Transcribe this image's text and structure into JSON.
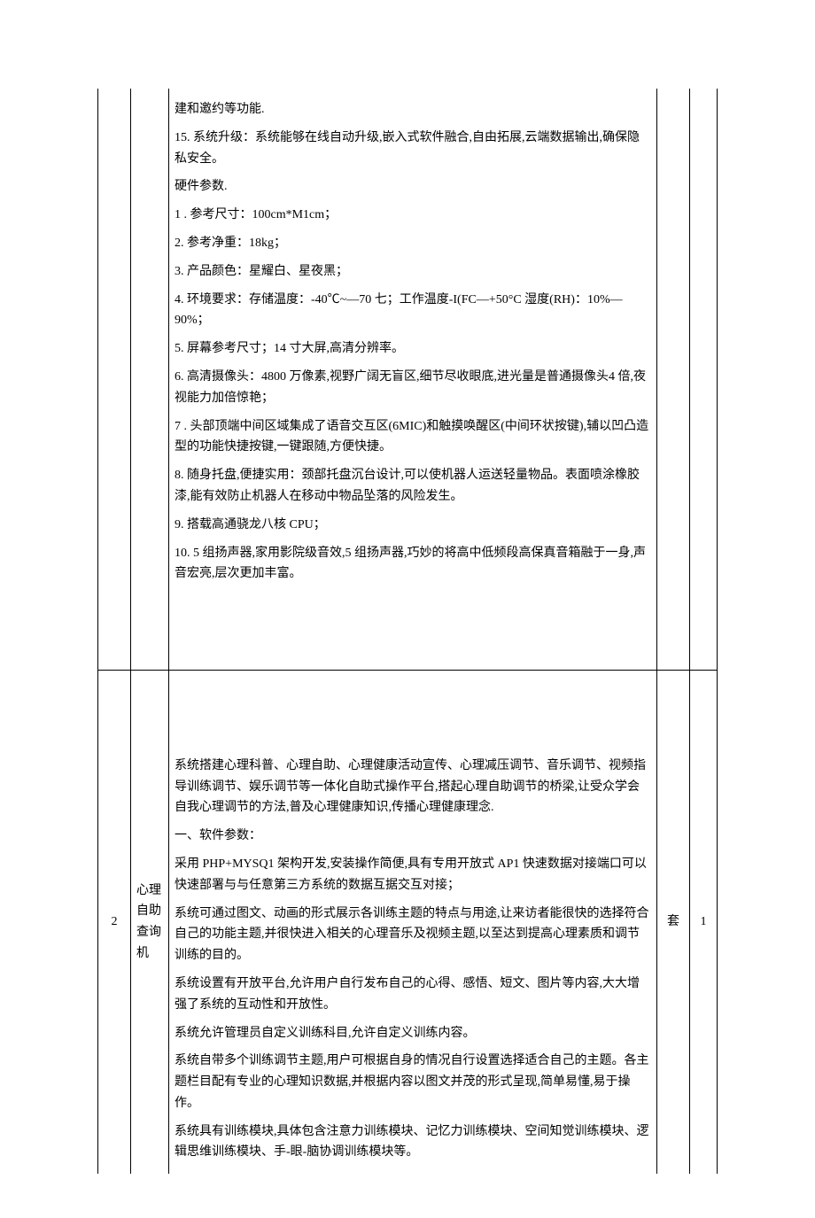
{
  "row1": {
    "idx": "",
    "name": "",
    "unit": "",
    "qty": "",
    "paragraphs": [
      "建和邀约等功能.",
      "15. 系统升级：系统能够在线自动升级,嵌入式软件融合,自由拓展,云端数据输出,确保隐私安全。",
      "硬件参数.",
      "1          . 参考尺寸：100cm*M1cm；",
      "2. 参考净重：18kg；",
      "3. 产品颜色：星耀白、星夜黑；",
      "4. 环境要求：存储温度：-40℃~—70 七；工作温度-I(FC—+50°C 湿度(RH)：10%—90%；",
      "5. 屏幕参考尺寸；14 寸大屏,高清分辨率。",
      "6. 高清摄像头：4800 万像素,视野广阔无盲区,细节尽收眼底,进光量是普通摄像头4 倍,夜视能力加倍惊艳；",
      "7          . 头部顶端中间区域集成了语音交互区(6MIC)和触摸唤醒区(中间环状按键),辅以凹凸造型的功能快捷按键,一键跟随,方便快捷。",
      "8. 随身托盘,便捷实用：颈部托盘沉台设计,可以使机器人运送轻量物品。表面喷涂橡胶漆,能有效防止机器人在移动中物品坠落的风险发生。",
      "9. 搭载高通骁龙八核 CPU；",
      "10. 5 组扬声器,家用影院级音效,5 组扬声器,巧妙的将高中低频段高保真音箱融于一身,声音宏亮,层次更加丰富。"
    ]
  },
  "row2": {
    "idx": "2",
    "name": "心理自助查询机",
    "unit": "套",
    "qty": "1",
    "paragraphs": [
      "系统搭建心理科普、心理自助、心理健康活动宣传、心理减压调节、音乐调节、视频指导训练调节、娱乐调节等一体化自助式操作平台,搭起心理自助调节的桥梁,让受众学会自我心理调节的方法,普及心理健康知识,传播心理健康理念.",
      "一、软件参数：",
      "采用 PHP+MYSQ1 架构开发,安装操作简便,具有专用开放式 AP1 快速数据对接端口可以快速部署与与任意第三方系统的数据互据交互对接；",
      "系统可通过图文、动画的形式展示各训练主题的特点与用途,让来访者能很快的选择符合自己的功能主题,并很快进入相关的心理音乐及视频主题,以至达到提高心理素质和调节训练的目的。",
      "系统设置有开放平台,允许用户自行发布自己的心得、感悟、短文、图片等内容,大大增强了系统的互动性和开放性。",
      "系统允许管理员自定义训练科目,允许自定义训练内容。",
      "系统自带多个训练调节主题,用户可根据自身的情况自行设置选择适合自己的主题。各主题栏目配有专业的心理知识数据,并根据内容以图文并茂的形式呈现,简单易懂,易于操作。",
      "系统具有训练模块,具体包含注意力训练模块、记忆力训练模块、空间知觉训练模块、逻辑思维训练模块、手-眼-脑协调训练模块等。"
    ]
  }
}
